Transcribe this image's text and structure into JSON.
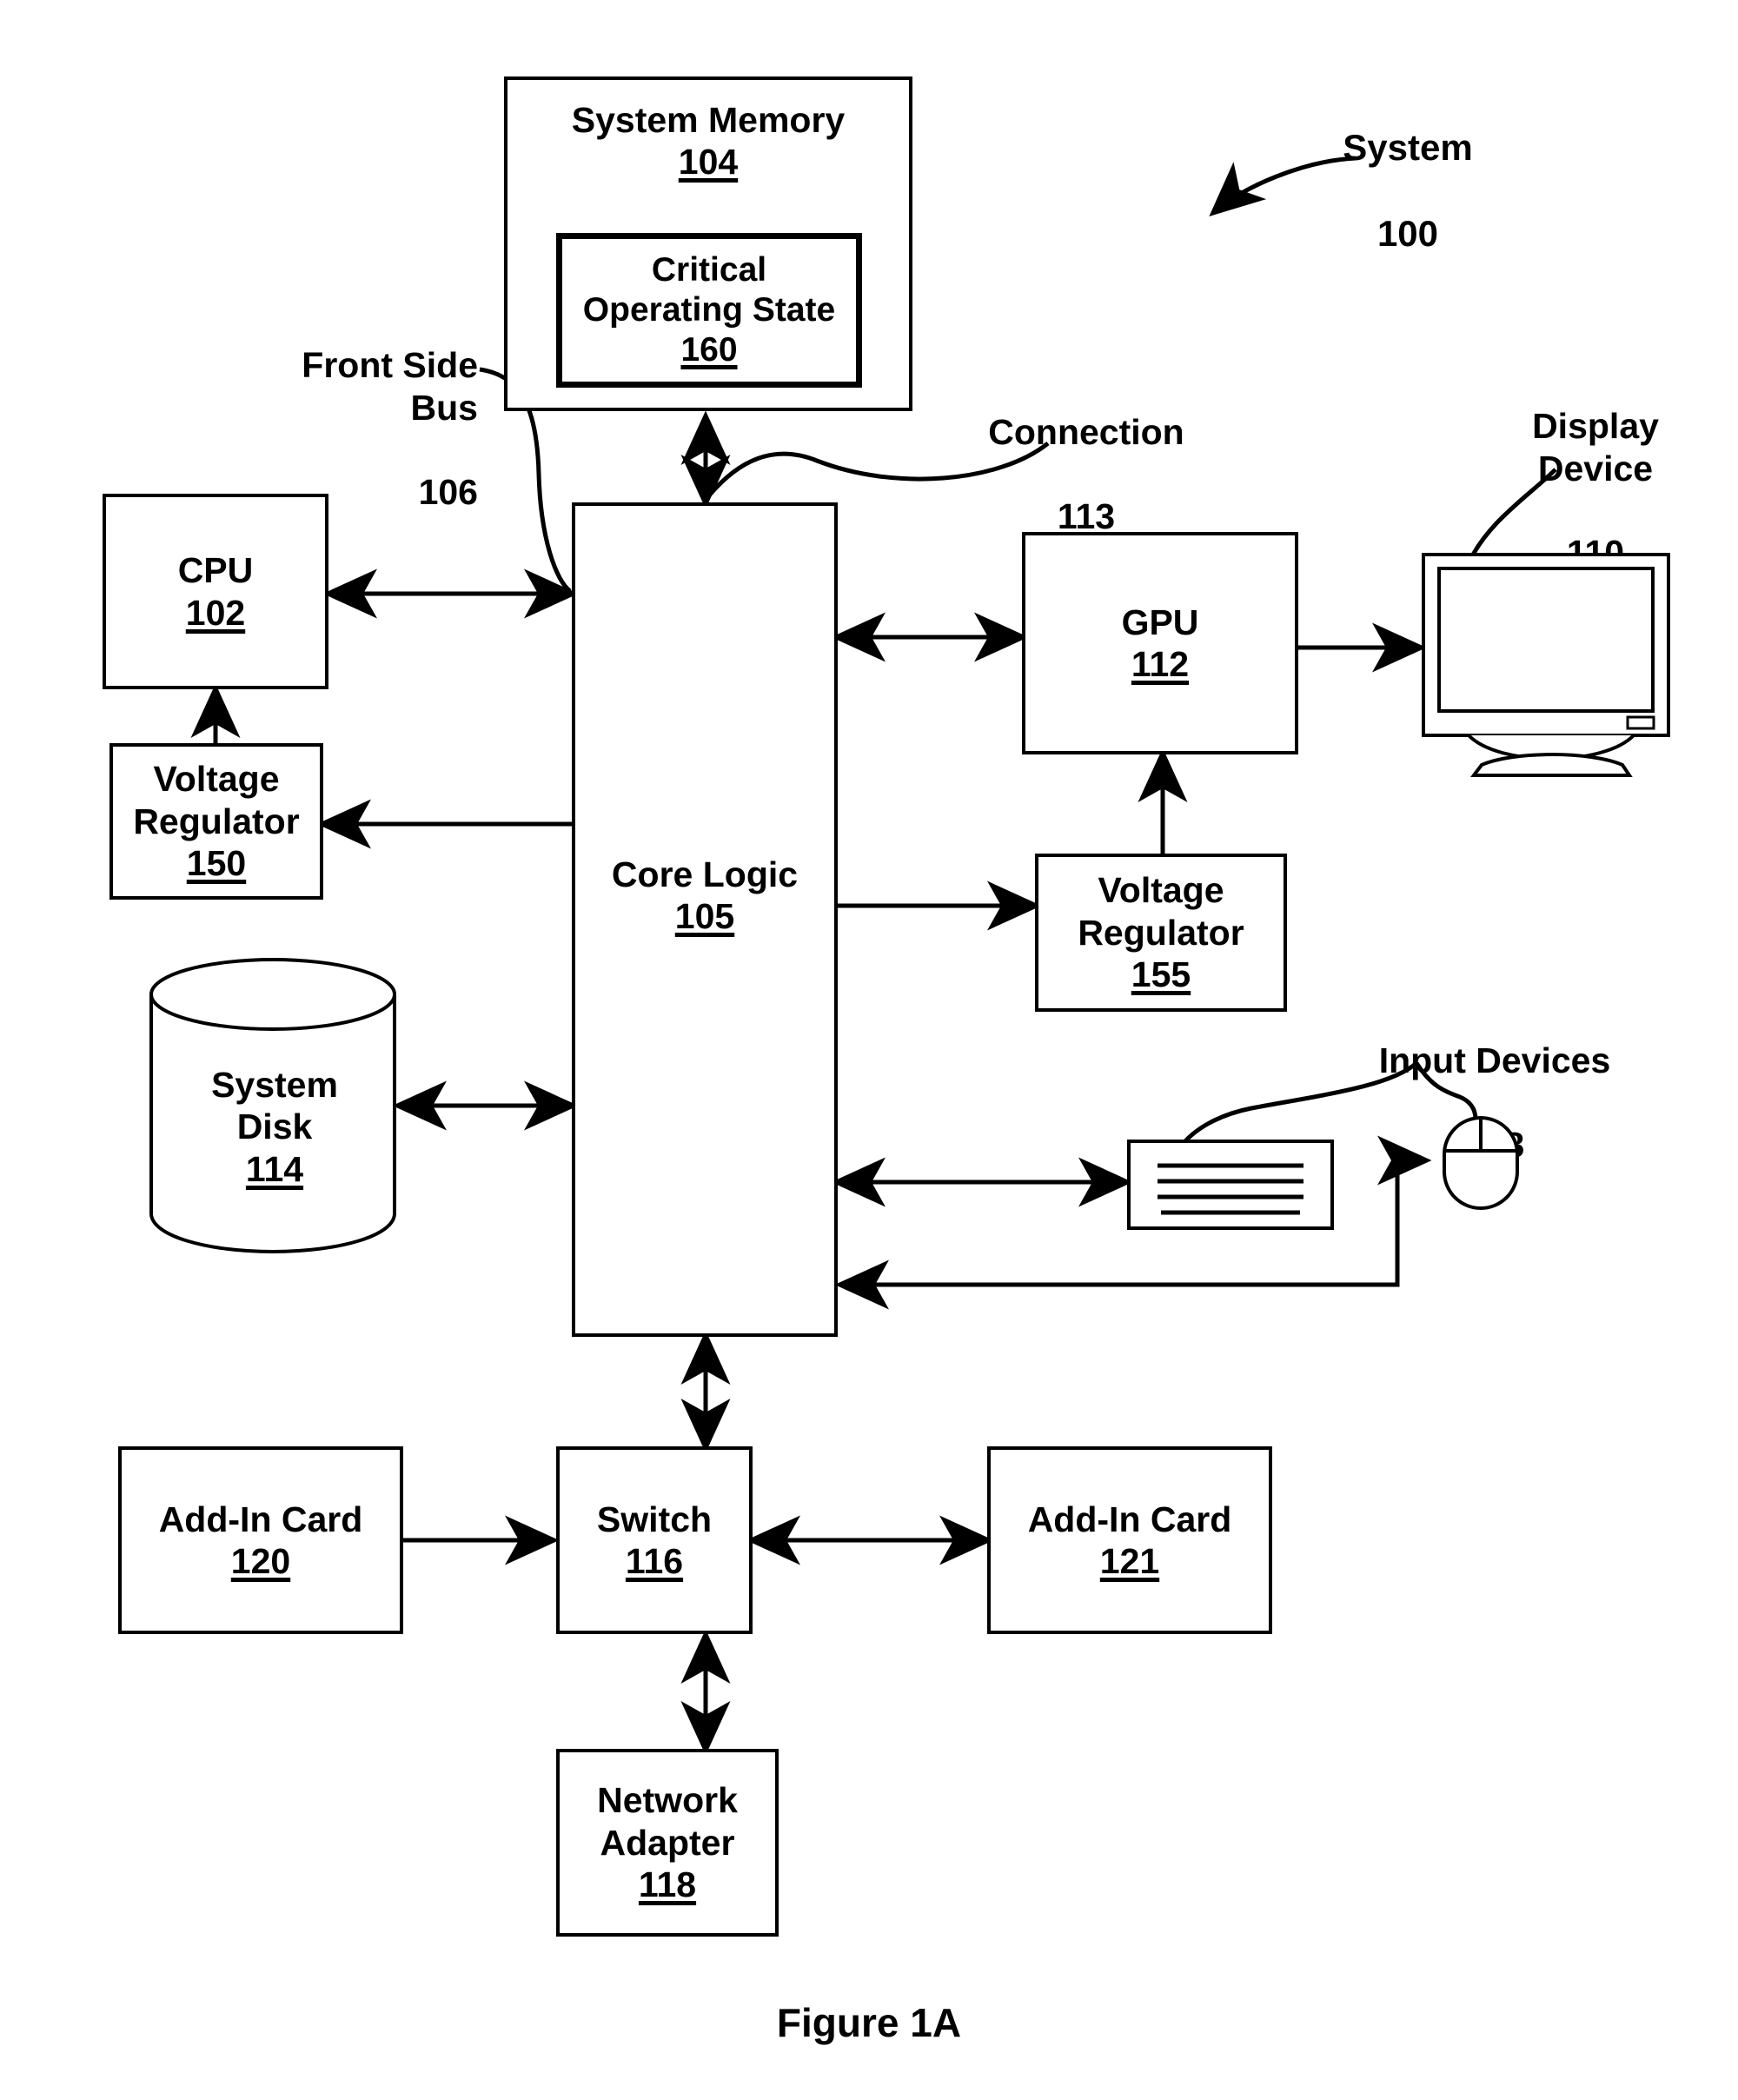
{
  "figure": {
    "caption": "Figure 1A",
    "system_label": {
      "title": "System",
      "number": "100"
    }
  },
  "blocks": {
    "system_memory": {
      "title": "System Memory",
      "number": "104"
    },
    "critical_state": {
      "title": "Critical\nOperating State",
      "number": "160"
    },
    "cpu": {
      "title": "CPU",
      "number": "102"
    },
    "voltage_regulator_cpu": {
      "title": "Voltage\nRegulator",
      "number": "150"
    },
    "core_logic": {
      "title": "Core Logic",
      "number": "105"
    },
    "gpu": {
      "title": "GPU",
      "number": "112"
    },
    "voltage_regulator_gpu": {
      "title": "Voltage\nRegulator",
      "number": "155"
    },
    "system_disk": {
      "title": "System\nDisk",
      "number": "114"
    },
    "switch": {
      "title": "Switch",
      "number": "116"
    },
    "add_in_card_left": {
      "title": "Add-In Card",
      "number": "120"
    },
    "add_in_card_right": {
      "title": "Add-In Card",
      "number": "121"
    },
    "network_adapter": {
      "title": "Network\nAdapter",
      "number": "118"
    }
  },
  "callouts": {
    "front_side_bus": {
      "title": "Front Side\nBus",
      "number": "106"
    },
    "connection": {
      "title": "Connection",
      "number": "113"
    },
    "display_device": {
      "title": "Display\nDevice",
      "number": "110"
    },
    "input_devices": {
      "title": "Input Devices",
      "number": "108"
    }
  },
  "colors": {
    "ink": "#000000",
    "paper": "#ffffff"
  }
}
